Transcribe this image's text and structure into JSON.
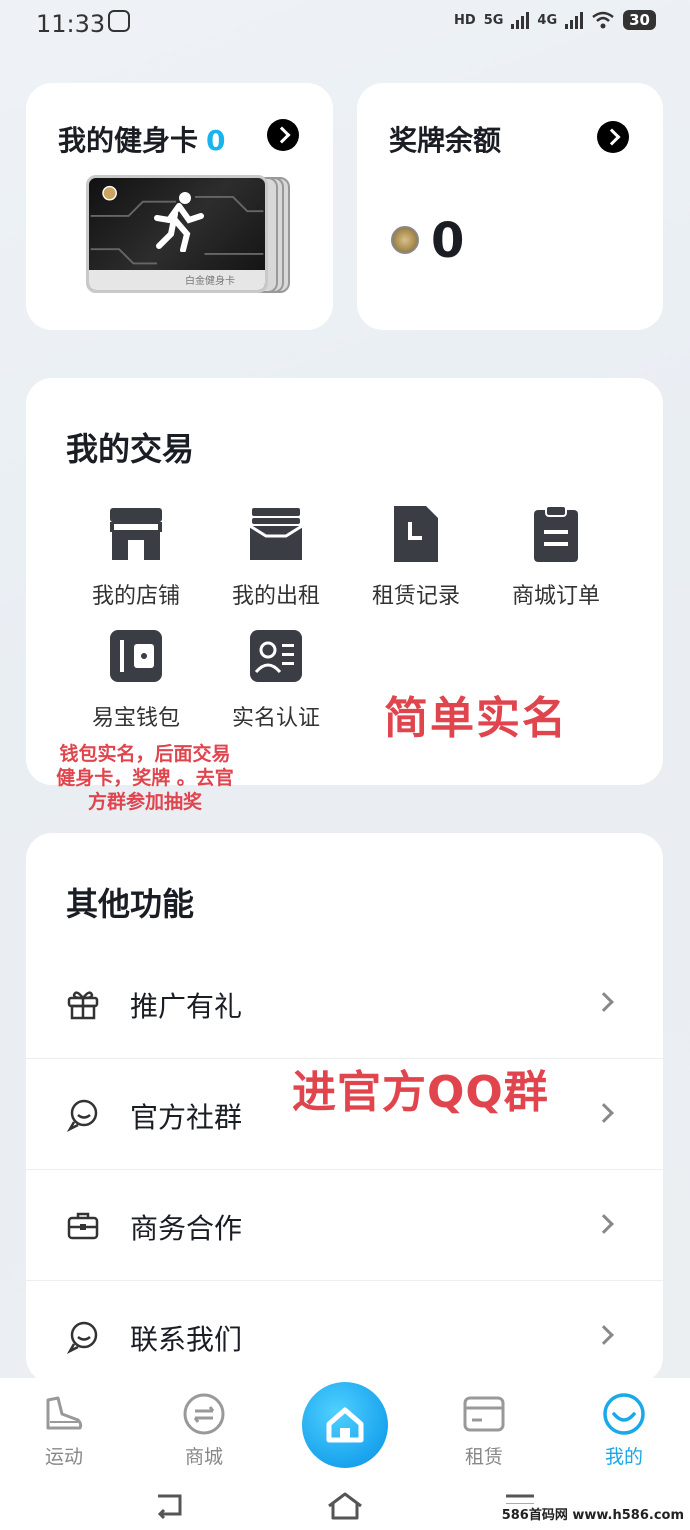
{
  "status": {
    "time": "11:33",
    "battery": "30",
    "hd_label": "HD",
    "net1": "5G",
    "net2": "4G"
  },
  "fitness_card": {
    "title": "我的健身卡",
    "count": "0",
    "card_label": "白金健身卡"
  },
  "medal": {
    "title": "奖牌余额",
    "balance": "0"
  },
  "trade": {
    "title": "我的交易",
    "items": [
      {
        "label": "我的店铺",
        "icon": "store-icon"
      },
      {
        "label": "我的出租",
        "icon": "wallet-card-icon"
      },
      {
        "label": "租赁记录",
        "icon": "document-icon"
      },
      {
        "label": "商城订单",
        "icon": "clipboard-icon"
      },
      {
        "label": "易宝钱包",
        "icon": "wallet-icon"
      },
      {
        "label": "实名认证",
        "icon": "id-card-icon"
      }
    ]
  },
  "annotations": {
    "simple_realname": "简单实名",
    "wallet_note_line1": "钱包实名，后面交易",
    "wallet_note_line2": "健身卡，奖牌 。去官",
    "wallet_note_line3": "方群参加抽奖",
    "qq_group": "进官方QQ群"
  },
  "other": {
    "title": "其他功能",
    "items": [
      {
        "label": "推广有礼",
        "icon": "gift-icon"
      },
      {
        "label": "官方社群",
        "icon": "chat-bubble-icon"
      },
      {
        "label": "商务合作",
        "icon": "briefcase-icon"
      },
      {
        "label": "联系我们",
        "icon": "chat-bubble-icon"
      }
    ]
  },
  "tabs": [
    {
      "label": "运动",
      "icon": "shoe-icon"
    },
    {
      "label": "商城",
      "icon": "mall-icon"
    },
    {
      "label": "",
      "icon": "home-icon"
    },
    {
      "label": "租赁",
      "icon": "rent-card-icon"
    },
    {
      "label": "我的",
      "icon": "profile-smile-icon"
    }
  ],
  "watermark": "586首码网 www.h586.com",
  "colors": {
    "accent": "#19a8e8",
    "annotation_red": "#e0454e",
    "text_dark": "#1a1d24"
  }
}
